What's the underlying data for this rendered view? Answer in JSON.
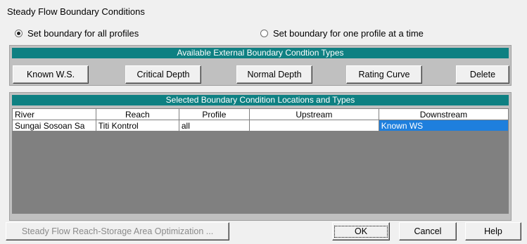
{
  "window": {
    "title": "Steady Flow Boundary Conditions"
  },
  "mode": {
    "all_profiles_label": "Set boundary for all profiles",
    "one_profile_label": "Set boundary for one profile at a time",
    "selected": "all"
  },
  "types_panel": {
    "header": "Available External Boundary Condtion Types",
    "buttons": {
      "known_ws": "Known W.S.",
      "critical_depth": "Critical Depth",
      "normal_depth": "Normal Depth",
      "rating_curve": "Rating Curve",
      "delete": "Delete"
    }
  },
  "locations_panel": {
    "header": "Selected Boundary Condition Locations and Types",
    "columns": [
      "River",
      "Reach",
      "Profile",
      "Upstream",
      "Downstream"
    ],
    "rows": [
      {
        "river": "Sungai Sosoan Sa",
        "reach": "Titi Kontrol",
        "profile": "all",
        "upstream": "",
        "downstream": "Known WS"
      }
    ]
  },
  "footer": {
    "optimization": "Steady Flow Reach-Storage Area Optimization ...",
    "ok": "OK",
    "cancel": "Cancel",
    "help": "Help"
  },
  "colors": {
    "band": "#0e8082",
    "selection": "#1e7fdd"
  }
}
